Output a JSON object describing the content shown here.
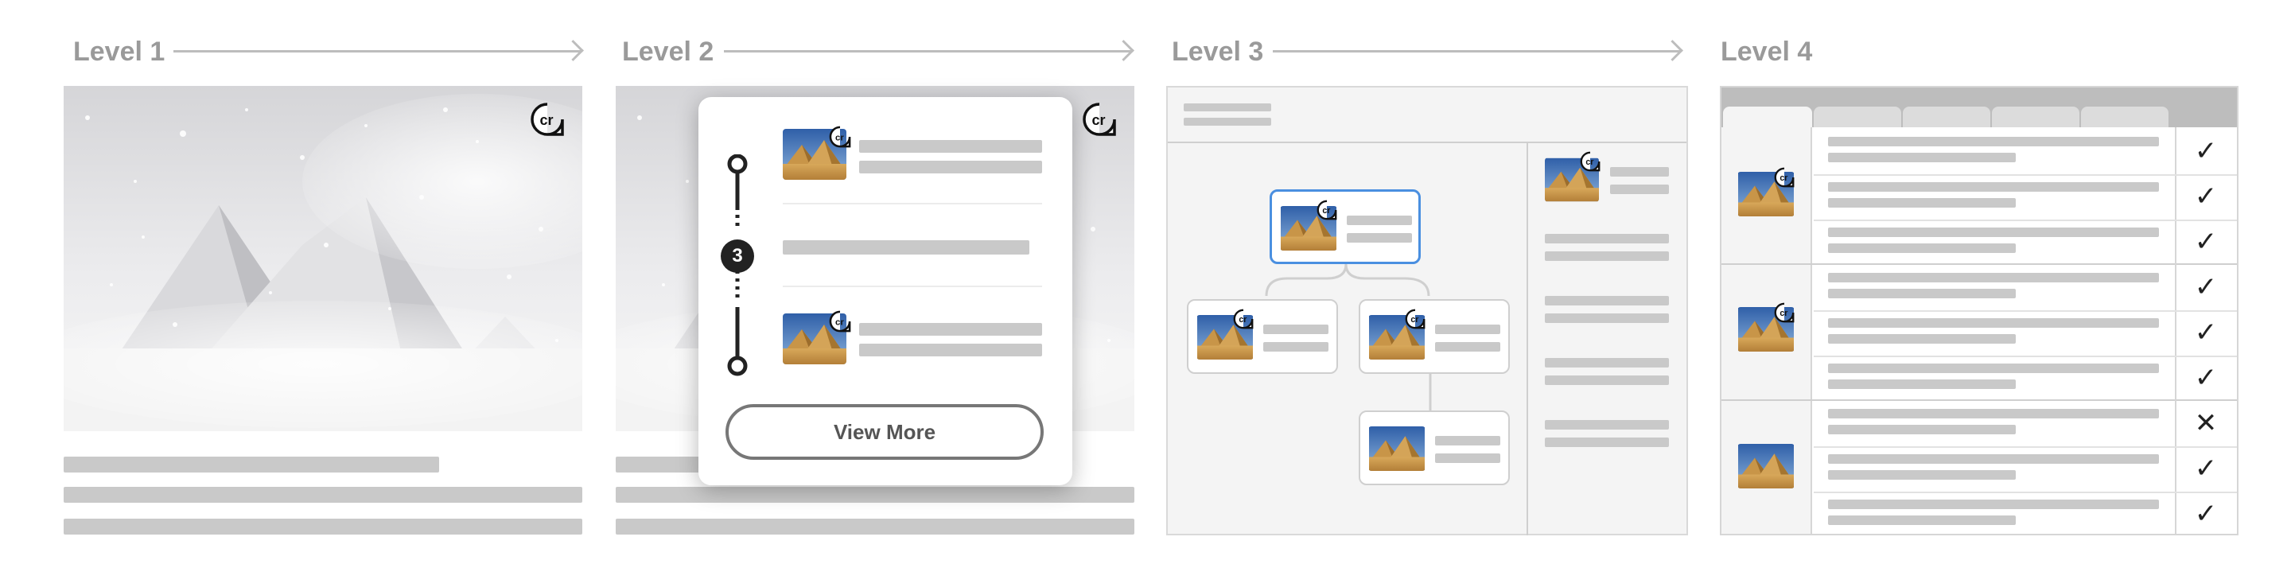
{
  "levels": [
    {
      "title": "Level 1"
    },
    {
      "title": "Level 2"
    },
    {
      "title": "Level 3"
    },
    {
      "title": "Level 4"
    }
  ],
  "badge_text": "cr",
  "level2": {
    "step_count": "3",
    "view_more_label": "View More"
  },
  "level4": {
    "checks": [
      "✓",
      "✓",
      "✓",
      "✓",
      "✓",
      "✓",
      "✕",
      "✓",
      "✓"
    ]
  },
  "colors": {
    "accent_selected": "#4a8fe0",
    "placeholder_bar": "#c9c9c9",
    "heading_gray": "#9a9a9a"
  }
}
